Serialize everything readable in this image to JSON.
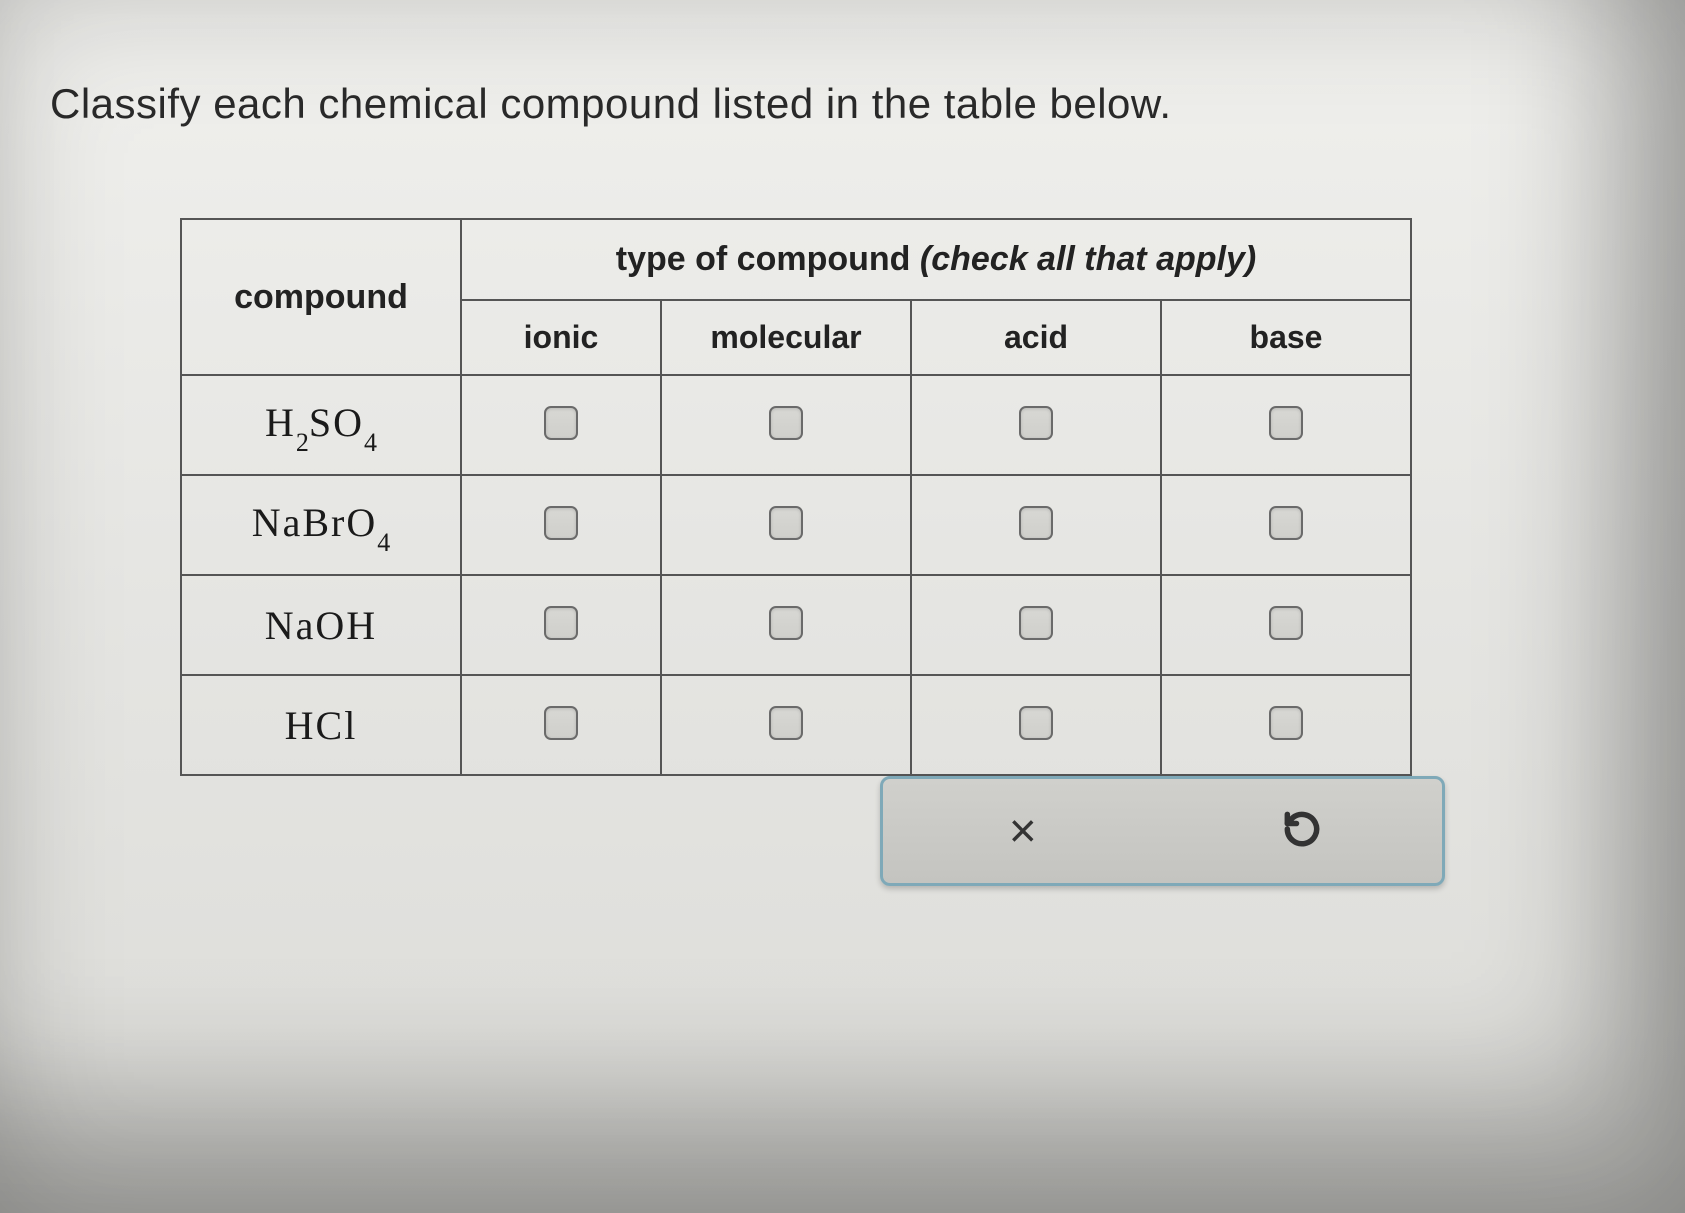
{
  "question": "Classify each chemical compound listed in the table below.",
  "headers": {
    "compound": "compound",
    "type_prefix": "type of compound ",
    "type_suffix": "(check all that apply)",
    "ionic": "ionic",
    "molecular": "molecular",
    "acid": "acid",
    "base": "base"
  },
  "compounds": [
    {
      "formula_html": "H<sub class='sub'>2</sub>SO<sub class='sub'>4</sub>",
      "plain": "H2SO4"
    },
    {
      "formula_html": "NaBrO<sub class='sub'>4</sub>",
      "plain": "NaBrO4"
    },
    {
      "formula_html": "NaOH",
      "plain": "NaOH"
    },
    {
      "formula_html": "HCl",
      "plain": "HCl"
    }
  ],
  "controls": {
    "clear": "×",
    "reset": "↺"
  }
}
